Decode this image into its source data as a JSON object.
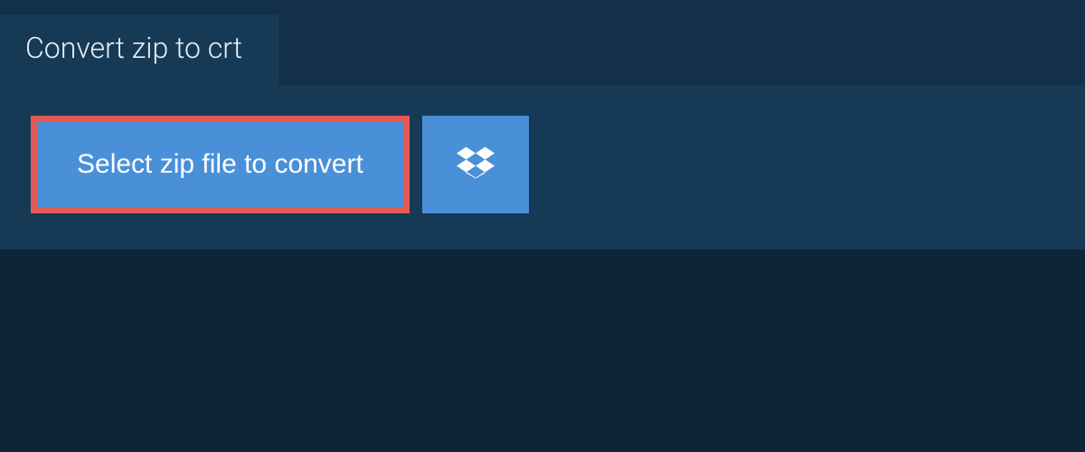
{
  "header": {
    "tab_label": "Convert zip to crt"
  },
  "actions": {
    "select_file_label": "Select zip file to convert",
    "dropbox_icon": "dropbox"
  }
}
